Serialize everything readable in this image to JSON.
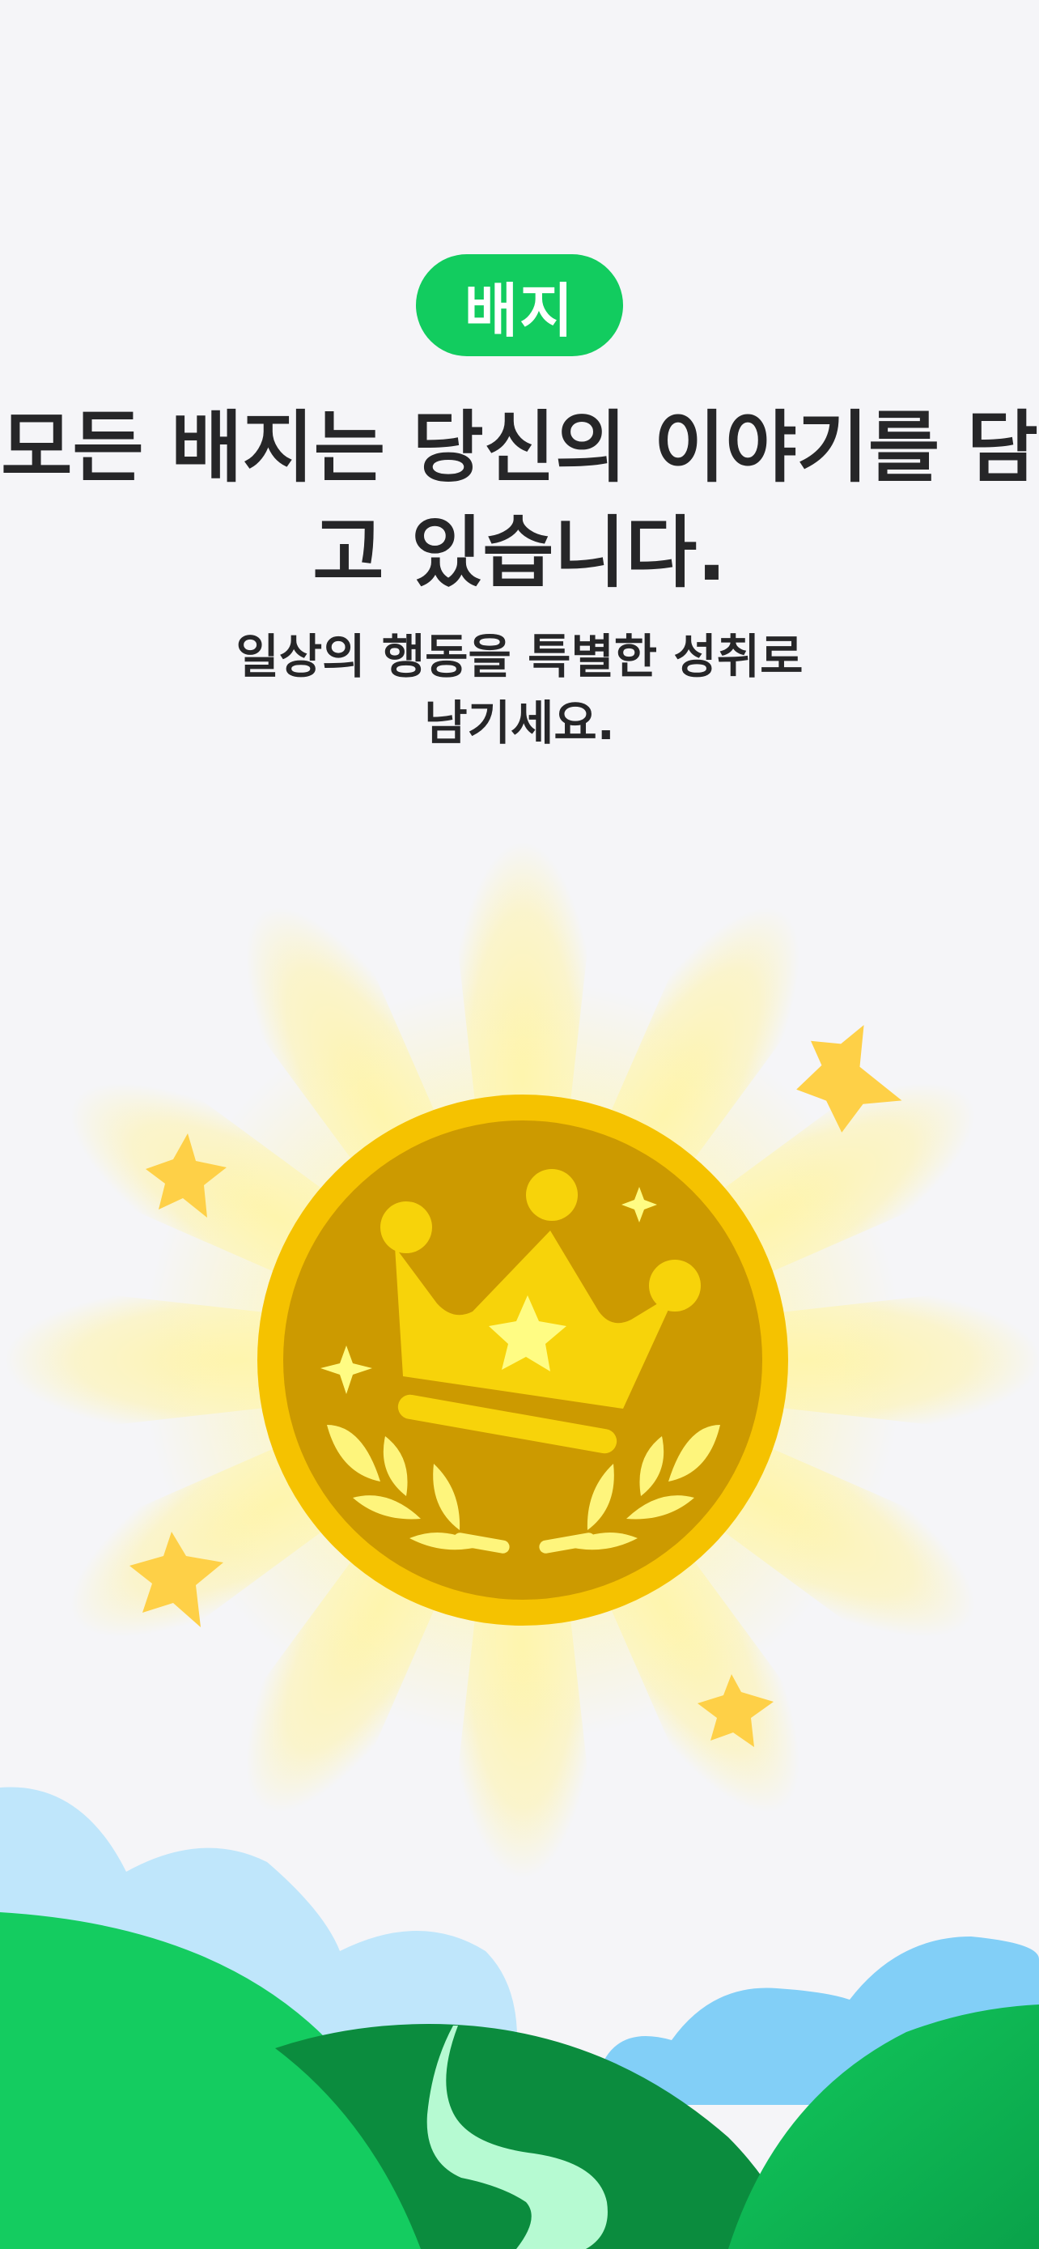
{
  "badge_pill": {
    "label": "배지"
  },
  "headline": {
    "line1": "모든 배지는 당신의 이야기를 담",
    "line2": "고 있습니다."
  },
  "subline": {
    "line1": "일상의 행동을 특별한 성취로",
    "line2": "남기세요."
  },
  "colors": {
    "background": "#f5f5f8",
    "accent_green": "#12cc5f",
    "text": "#262628",
    "coin_rim": "#f5c200",
    "coin_face": "#cc9a00",
    "crown": "#f7d30a",
    "sky_light": "#bfe6fb",
    "sky_blue": "#82cff7",
    "hill_green": "#14cc60",
    "hill_dark": "#0b8c3e",
    "path": "#b6fad2"
  },
  "illustration": {
    "center_icon": "crown-medal-icon",
    "decor_icons": [
      "sparkle-star-icon",
      "laurel-icon",
      "sun-ray-burst",
      "cloud-icon",
      "hill-icon",
      "path-icon"
    ]
  }
}
